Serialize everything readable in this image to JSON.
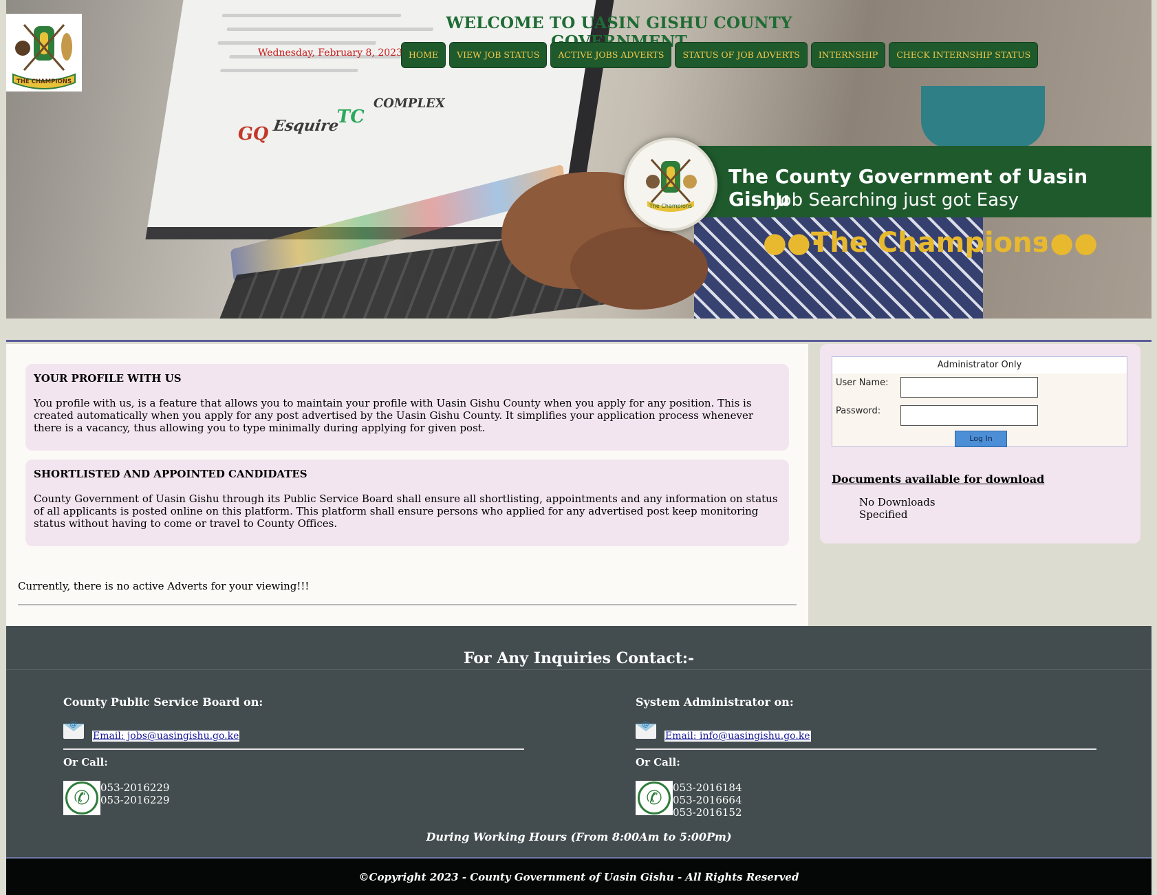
{
  "header": {
    "site_title": "WELCOME TO UASIN GISHU COUNTY GOVERNMENT",
    "date": "Wednesday, February 8, 2023 | |",
    "logo_caption": "THE CHAMPIONS",
    "nav": [
      {
        "label": "HOME"
      },
      {
        "label": "VIEW JOB STATUS"
      },
      {
        "label": "ACTIVE JOBS ADVERTS"
      },
      {
        "label": "STATUS OF JOB ADVERTS"
      },
      {
        "label": "INTERNSHIP"
      },
      {
        "label": "CHECK INTERNSHIP STATUS"
      }
    ]
  },
  "banner": {
    "title": "The County Government of Uasin Gishu",
    "subtitle": "Job Searching just got Easy",
    "tagline": "The Champions",
    "emblem_caption": "The Champions",
    "screen_brands": [
      "GQ",
      "Esquire",
      "TC",
      "COMPLEX"
    ]
  },
  "main": {
    "profile_card": {
      "heading": "YOUR PROFILE WITH US",
      "body": "You profile with us, is a feature that allows you to maintain your profile with Uasin Gishu County when you apply for any position. This is created automatically when you apply for any post advertised by the Uasin Gishu County. It simplifies your application process whenever there is a vacancy, thus allowing you to type minimally during applying for given post."
    },
    "shortlist_card": {
      "heading": "SHORTLISTED AND APPOINTED CANDIDATES",
      "body": "County Government of Uasin Gishu through its Public Service Board shall ensure all shortlisting, appointments and any information on status of all applicants is posted online on this platform. This platform shall ensure persons who applied for any advertised post keep monitoring status without having to come or travel to County Offices."
    },
    "no_adverts": "Currently, there is no active Adverts for your viewing!!!"
  },
  "sidebar": {
    "login": {
      "heading": "Administrator Only",
      "username_label": "User Name:",
      "password_label": "Password:",
      "button_label": "Log In"
    },
    "downloads_title": "Documents available for download",
    "downloads_empty": "No Downloads Specified"
  },
  "footer": {
    "title": "For Any Inquiries Contact:-",
    "left": {
      "heading": "County Public Service Board on:",
      "email": "Email: jobs@uasingishu.go.ke",
      "call_label": "Or Call:",
      "phones": [
        "053-2016229",
        "053-2016229"
      ]
    },
    "right": {
      "heading": "System Administrator on:",
      "email": "Email: info@uasingishu.go.ke",
      "call_label": "Or Call:",
      "phones": [
        "053-2016184",
        "053-2016664",
        "053-2016152"
      ]
    },
    "hours": "During Working Hours (From 8:00Am to 5:00Pm)",
    "copyright": "©Copyright 2023 - County Government of Uasin Gishu - All Rights Reserved"
  },
  "colors": {
    "brand_green": "#1f5a2c",
    "nav_text": "#f2c94c",
    "title_green": "#1e6b33",
    "date_red": "#c81a1a",
    "card_bg": "#f2e5f0",
    "footer_bg": "#434c4e"
  }
}
